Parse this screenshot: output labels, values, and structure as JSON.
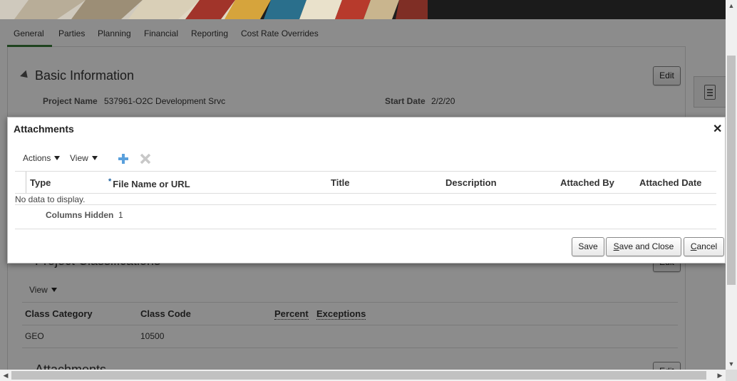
{
  "tabs": [
    "General",
    "Parties",
    "Planning",
    "Financial",
    "Reporting",
    "Cost Rate Overrides"
  ],
  "basic_info": {
    "title": "Basic Information",
    "edit_label": "Edit",
    "project_name_label": "Project Name",
    "project_name_value": "537961-O2C Development Srvc",
    "start_date_label": "Start Date",
    "start_date_value": "2/2/20"
  },
  "classifications": {
    "title": "Project Classifications",
    "edit_label": "Edit",
    "view_label": "View",
    "columns": [
      "Class Category",
      "Class Code",
      "Percent",
      "Exceptions"
    ],
    "rows": [
      {
        "category": "GEO",
        "code": "10500"
      }
    ]
  },
  "attachments_section": {
    "title": "Attachments",
    "edit_label": "Edit"
  },
  "dialog": {
    "title": "Attachments",
    "close_glyph": "✕",
    "actions_label": "Actions",
    "view_label": "View",
    "columns": [
      "Type",
      "File Name or URL",
      "Title",
      "Description",
      "Attached By",
      "Attached Date"
    ],
    "required_marker": "*",
    "empty_text": "No data to display.",
    "columns_hidden_label": "Columns Hidden",
    "columns_hidden_value": "1",
    "save_label": "Save",
    "save_close_label": "Save and Close",
    "cancel_label": "Cancel"
  },
  "colors": {
    "accent_tab": "#3a7a3a",
    "add_icon": "#5aa0dc",
    "remove_icon_disabled": "#c8c8c8"
  }
}
